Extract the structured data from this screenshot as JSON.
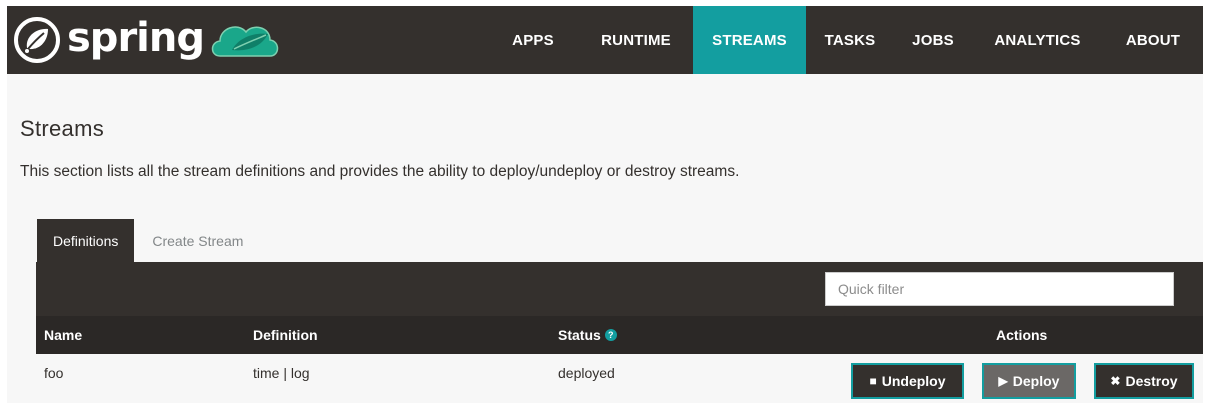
{
  "brand": {
    "text": "spring"
  },
  "nav": {
    "items": [
      {
        "label": "APPS",
        "active": false
      },
      {
        "label": "RUNTIME",
        "active": false
      },
      {
        "label": "STREAMS",
        "active": true
      },
      {
        "label": "TASKS",
        "active": false
      },
      {
        "label": "JOBS",
        "active": false
      },
      {
        "label": "ANALYTICS",
        "active": false
      },
      {
        "label": "ABOUT",
        "active": false
      }
    ]
  },
  "page": {
    "title": "Streams",
    "description": "This section lists all the stream definitions and provides the ability to deploy/undeploy or destroy streams."
  },
  "tabs": [
    {
      "label": "Definitions",
      "active": true
    },
    {
      "label": "Create Stream",
      "active": false
    }
  ],
  "filter": {
    "placeholder": "Quick filter",
    "value": ""
  },
  "table": {
    "headers": {
      "name": "Name",
      "definition": "Definition",
      "status": "Status",
      "actions": "Actions"
    },
    "rows": [
      {
        "name": "foo",
        "definition": "time | log",
        "status": "deployed"
      }
    ]
  },
  "actions": {
    "undeploy": "Undeploy",
    "deploy": "Deploy",
    "destroy": "Destroy"
  },
  "colors": {
    "navbar": "#34302d",
    "accent": "#139ea0",
    "background": "#f7f7f7"
  },
  "icons": {
    "help": "question-icon",
    "undeploy": "stop-icon",
    "deploy": "play-icon",
    "destroy": "close-icon"
  }
}
